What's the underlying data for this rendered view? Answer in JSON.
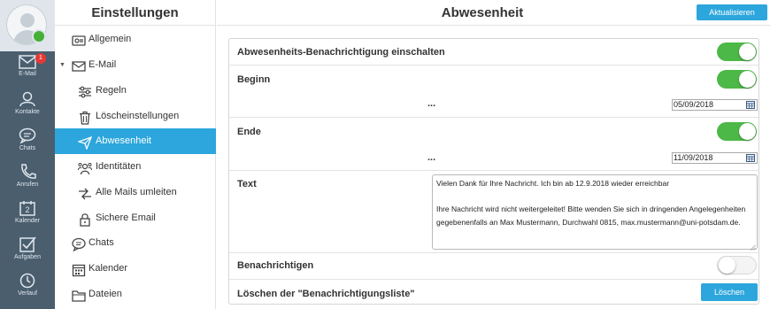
{
  "rail": {
    "items": [
      {
        "label": "E-Mail",
        "icon": "mail-icon",
        "badge": "1"
      },
      {
        "label": "Kontakte",
        "icon": "contacts-icon"
      },
      {
        "label": "Chats",
        "icon": "chat-icon"
      },
      {
        "label": "Anrufen",
        "icon": "phone-icon"
      },
      {
        "label": "Kalender",
        "icon": "calendar-icon",
        "icon_text": "2"
      },
      {
        "label": "Aufgaben",
        "icon": "tasks-icon"
      },
      {
        "label": "Verlauf",
        "icon": "history-icon"
      }
    ]
  },
  "sidebar": {
    "title": "Einstellungen",
    "items": [
      {
        "label": "Allgemein",
        "icon": "general-settings-icon"
      },
      {
        "label": "E-Mail",
        "icon": "mail-icon"
      },
      {
        "label": "Regeln",
        "icon": "rules-icon"
      },
      {
        "label": "Löscheinstellungen",
        "icon": "trash-icon"
      },
      {
        "label": "Abwesenheit",
        "icon": "plane-icon",
        "active": true
      },
      {
        "label": "Identitäten",
        "icon": "identities-icon"
      },
      {
        "label": "Alle Mails umleiten",
        "icon": "redirect-icon"
      },
      {
        "label": "Sichere Email",
        "icon": "lock-icon"
      },
      {
        "label": "Chats",
        "icon": "chat-icon"
      },
      {
        "label": "Kalender",
        "icon": "calendar-icon"
      },
      {
        "label": "Dateien",
        "icon": "folder-icon"
      }
    ]
  },
  "header": {
    "title": "Abwesenheit",
    "refresh_label": "Aktualisieren"
  },
  "form": {
    "enable_label": "Abwesenheits-Benachrichtigung einschalten",
    "enable_on": true,
    "start_label": "Beginn",
    "start_on": true,
    "start_dots": "...",
    "start_date": "05/09/2018",
    "end_label": "Ende",
    "end_on": true,
    "end_dots": "...",
    "end_date": "11/09/2018",
    "text_label": "Text",
    "text_line1": "Vielen Dank für Ihre Nachricht. Ich bin ab 12.9.2018 wieder erreichbar",
    "text_line2": "Ihre Nachricht wird nicht weitergeleitet! Bitte wenden Sie sich in dringenden Angelegenheiten gegebenenfalls an Max Mustermann, Durchwahl 0815, max.mustermann@uni-potsdam.de.",
    "notify_label": "Benachrichtigen",
    "notify_on": false,
    "clear_label": "Löschen der \"Benachrichtigungsliste\"",
    "clear_button": "Löschen"
  },
  "colors": {
    "accent": "#2ca6dc",
    "toggle_on": "#4cb847",
    "rail": "#4a5e6e",
    "badge": "#e53935"
  }
}
